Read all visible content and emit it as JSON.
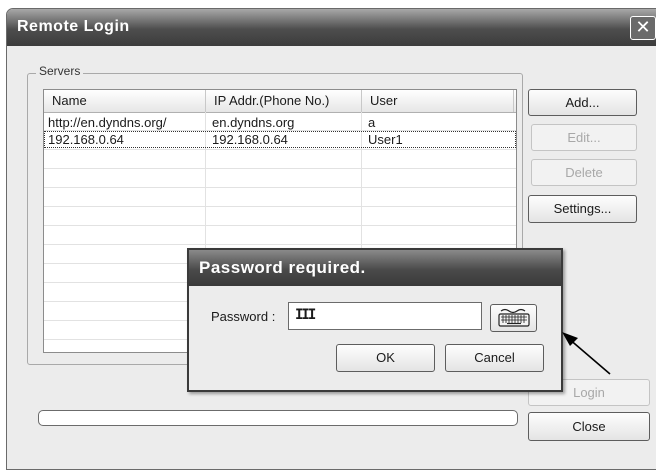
{
  "window": {
    "title": "Remote Login",
    "close_glyph": "✕"
  },
  "servers": {
    "group_label": "Servers",
    "columns": [
      "Name",
      "IP Addr.(Phone No.)",
      "User"
    ],
    "rows": [
      {
        "name": "http://en.dyndns.org/",
        "ip": "en.dyndns.org",
        "user": "a"
      },
      {
        "name": "192.168.0.64",
        "ip": "192.168.0.64",
        "user": "User1"
      }
    ]
  },
  "buttons": {
    "add": "Add...",
    "edit": "Edit...",
    "delete": "Delete",
    "settings": "Settings...",
    "login": "Login",
    "close": "Close"
  },
  "progress": {
    "value": 0
  },
  "password_dialog": {
    "title": "Password required.",
    "password_label": "Password :",
    "password_value": "III",
    "ok": "OK",
    "cancel": "Cancel",
    "keyboard_icon": "keyboard-icon"
  }
}
